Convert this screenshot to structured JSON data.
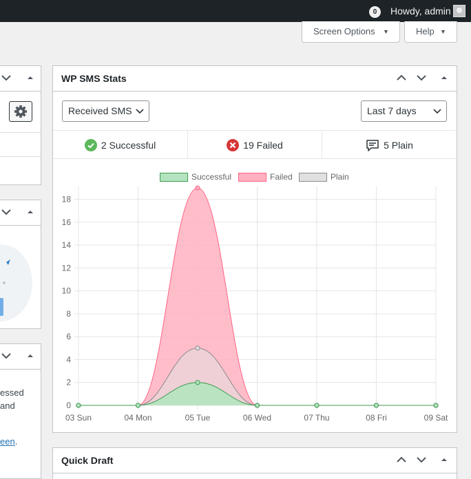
{
  "admin_bar": {
    "comment_count": "0",
    "greeting": "Howdy, admin"
  },
  "screen_meta": {
    "screen_options": "Screen Options",
    "help": "Help"
  },
  "left_column": {
    "text_lines": [
      "essed",
      "and"
    ],
    "link_text": "een",
    "link_suffix": "."
  },
  "sms_widget": {
    "title": "WP SMS Stats",
    "type_select": "Received SMS",
    "range_select": "Last 7 days",
    "stats": [
      {
        "icon": "check-circle-icon",
        "label": "2 Successful"
      },
      {
        "icon": "x-circle-icon",
        "label": "19 Failed"
      },
      {
        "icon": "message-icon",
        "label": "5 Plain"
      }
    ]
  },
  "quick_draft": {
    "title": "Quick Draft"
  },
  "colors": {
    "successful_fill": "#b4e4bf",
    "successful_line": "#3a9a4f",
    "failed_fill": "#ffb1c1",
    "failed_line": "#ff6384",
    "plain_fill": "#e0e0e0",
    "plain_line": "#8b8b8b"
  },
  "chart_data": {
    "type": "area",
    "categories": [
      "03 Sun",
      "04 Mon",
      "05 Tue",
      "06 Wed",
      "07 Thu",
      "08 Fri",
      "09 Sat"
    ],
    "series": [
      {
        "name": "Failed",
        "values": [
          0,
          0,
          19,
          0,
          0,
          0,
          0
        ]
      },
      {
        "name": "Plain",
        "values": [
          0,
          0,
          5,
          0,
          0,
          0,
          0
        ]
      },
      {
        "name": "Successful",
        "values": [
          0,
          0,
          2,
          0,
          0,
          0,
          0
        ]
      }
    ],
    "legend": [
      "Successful",
      "Failed",
      "Plain"
    ],
    "ylim": [
      0,
      19
    ],
    "yticks": [
      0,
      2,
      4,
      6,
      8,
      10,
      12,
      14,
      16,
      18
    ],
    "grid": true,
    "legend_position": "top"
  }
}
